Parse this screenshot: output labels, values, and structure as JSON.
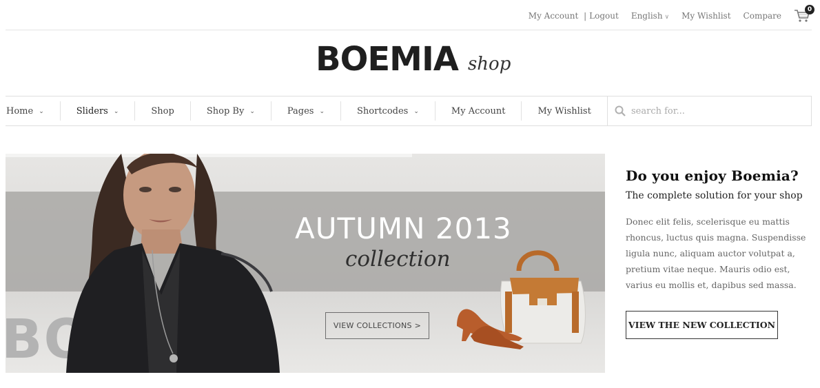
{
  "topbar": {
    "account": "My Account",
    "separator": "|",
    "logout": "Logout",
    "language": "English",
    "wishlist": "My Wishlist",
    "compare": "Compare",
    "cart_count": "0"
  },
  "logo": {
    "main": "BOEMIA",
    "sub": "shop"
  },
  "nav": {
    "items": [
      {
        "label": "Home",
        "dropdown": true
      },
      {
        "label": "Sliders",
        "dropdown": true
      },
      {
        "label": "Shop",
        "dropdown": false
      },
      {
        "label": "Shop By",
        "dropdown": true
      },
      {
        "label": "Pages",
        "dropdown": true
      },
      {
        "label": "Shortcodes",
        "dropdown": true
      },
      {
        "label": "My Account",
        "dropdown": false
      },
      {
        "label": "My Wishlist",
        "dropdown": false
      }
    ],
    "search_placeholder": "search for..."
  },
  "hero": {
    "title": "AUTUMN 2013",
    "subtitle": "collection",
    "button": "VIEW COLLECTIONS >",
    "ghost_text": "BOE"
  },
  "promo": {
    "title": "Do you enjoy Boemia?",
    "subtitle": "The complete solution for your shop",
    "text": "Donec elit felis, scelerisque eu mattis rhoncus, luctus quis magna. Suspendisse ligula nunc, aliquam auctor volutpat a, pretium vitae neque. Mauris odio est, varius eu mollis et, dapibus sed massa.",
    "button": "VIEW THE NEW COLLECTION"
  },
  "icons": {
    "cart": "cart-icon",
    "search": "search-icon",
    "chevron": "chevron-down-icon"
  }
}
